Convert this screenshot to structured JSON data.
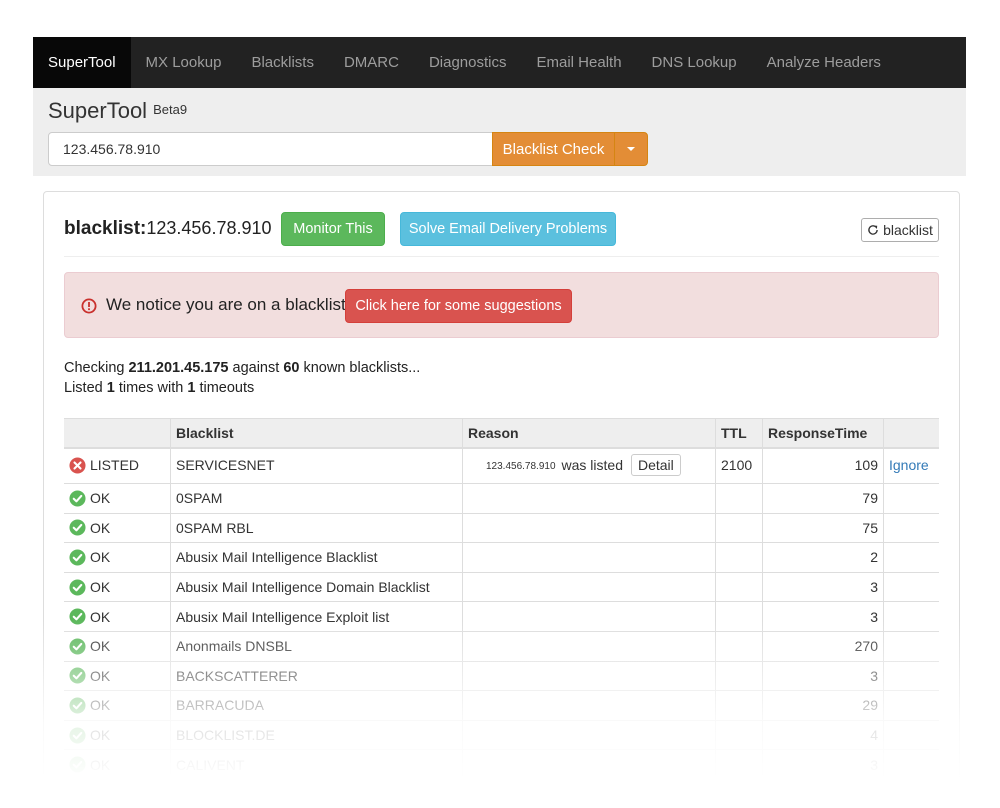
{
  "navbar": {
    "items": [
      {
        "label": "SuperTool",
        "active": true
      },
      {
        "label": "MX Lookup"
      },
      {
        "label": "Blacklists"
      },
      {
        "label": "DMARC"
      },
      {
        "label": "Diagnostics"
      },
      {
        "label": "Email Health"
      },
      {
        "label": "DNS Lookup"
      },
      {
        "label": "Analyze Headers"
      }
    ]
  },
  "header": {
    "brand": "SuperTool",
    "beta": "Beta9",
    "search_value": "123.456.78.910",
    "check_button": "Blacklist Check"
  },
  "result": {
    "title_label": "blacklist:",
    "title_value": "123.456.78.910",
    "monitor_button": "Monitor This",
    "solve_button": "Solve Email Delivery Problems",
    "refresh_button": "blacklist"
  },
  "alert": {
    "text": "We notice you are on a blacklist.",
    "button": "Click here for some suggestions"
  },
  "summary": {
    "checking_prefix": "Checking",
    "checked_ip": "211.201.45.175",
    "against": "against",
    "count": "60",
    "known": "known blacklists...",
    "listed_prefix": "Listed",
    "listed_count": "1",
    "times_with": "times with",
    "timeouts_count": "1",
    "timeouts": "timeouts"
  },
  "table": {
    "headers": [
      "",
      "Blacklist",
      "Reason",
      "TTL",
      "ResponseTime",
      ""
    ],
    "listed_row": {
      "status": "LISTED",
      "blacklist": "SERVICESNET",
      "reason_ip": "123.456.78.910",
      "reason_text": "was listed",
      "detail_button": "Detail",
      "ttl": "2100",
      "response": "109",
      "action": "Ignore"
    },
    "rows": [
      {
        "status": "OK",
        "blacklist": "0SPAM",
        "response": "79"
      },
      {
        "status": "OK",
        "blacklist": "0SPAM RBL",
        "response": "75"
      },
      {
        "status": "OK",
        "blacklist": "Abusix Mail Intelligence Blacklist",
        "response": "2"
      },
      {
        "status": "OK",
        "blacklist": "Abusix Mail Intelligence Domain Blacklist",
        "response": "3"
      },
      {
        "status": "OK",
        "blacklist": "Abusix Mail Intelligence Exploit list",
        "response": "3"
      },
      {
        "status": "OK",
        "blacklist": "Anonmails DNSBL",
        "response": "270"
      },
      {
        "status": "OK",
        "blacklist": "BACKSCATTERER",
        "response": "3"
      },
      {
        "status": "OK",
        "blacklist": "BARRACUDA",
        "response": "29"
      },
      {
        "status": "OK",
        "blacklist": "BLOCKLIST.DE",
        "response": "4"
      },
      {
        "status": "OK",
        "blacklist": "CALIVENT",
        "response": "3"
      }
    ]
  },
  "colors": {
    "nav_bg": "#222222",
    "warning_orange": "#e38d36",
    "success_green": "#5cb85c",
    "info_blue": "#5bc0de",
    "danger_red": "#d9534f",
    "ok_icon": "#5cb85c",
    "listed_icon": "#d9534f"
  },
  "icons": {
    "refresh": "refresh-icon",
    "alert": "exclamation-circle-icon",
    "ok": "check-circle-icon",
    "listed": "x-circle-icon"
  }
}
